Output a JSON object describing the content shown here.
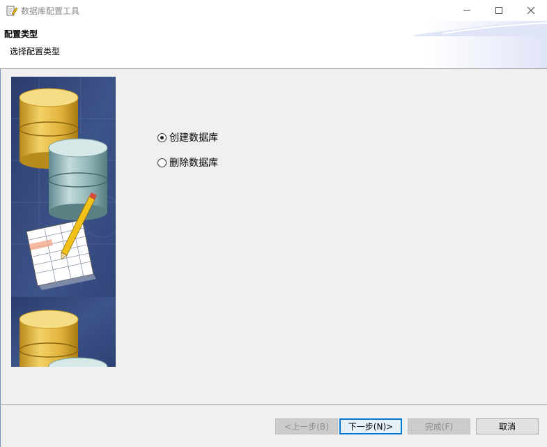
{
  "window": {
    "title": "数据库配置工具",
    "icon": "database-edit-icon",
    "controls": [
      "minimize-icon",
      "maximize-icon",
      "close-icon"
    ]
  },
  "header": {
    "title": "配置类型",
    "subtitle": "选择配置类型"
  },
  "options": [
    {
      "label": "创建数据库",
      "selected": true
    },
    {
      "label": "删除数据库",
      "selected": false
    }
  ],
  "buttons": {
    "back": {
      "label": "<上一步(B)",
      "enabled": false
    },
    "next": {
      "label": "下一步(N)>",
      "enabled": true,
      "default": true
    },
    "finish": {
      "label": "完成(F)",
      "enabled": false
    },
    "cancel": {
      "label": "取消",
      "enabled": true
    }
  },
  "colors": {
    "accent": "#0078d7",
    "panel": "#f0f0f0",
    "side_image_bg": "#34497e",
    "gold": "#e0b640",
    "teal": "#8fb3b5"
  }
}
